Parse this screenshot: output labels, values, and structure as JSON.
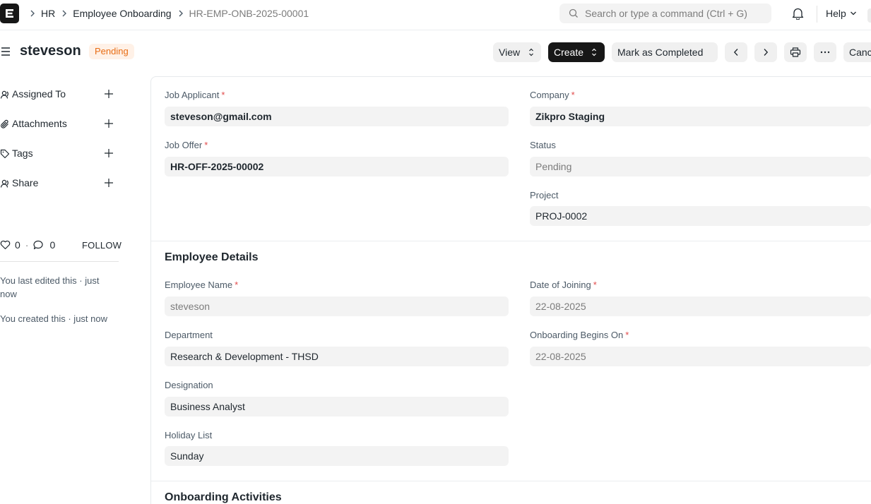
{
  "navbar": {
    "breadcrumbs": [
      "HR",
      "Employee Onboarding",
      "HR-EMP-ONB-2025-00001"
    ],
    "search_placeholder": "Search or type a command (Ctrl + G)",
    "help_label": "Help"
  },
  "page": {
    "title": "steveson",
    "status_badge": "Pending",
    "buttons": {
      "view": "View",
      "create": "Create",
      "mark_completed": "Mark as Completed",
      "cancel": "Cancel"
    }
  },
  "sidebar": {
    "items": [
      {
        "label": "Assigned To",
        "icon": "assign-icon"
      },
      {
        "label": "Attachments",
        "icon": "paperclip-icon"
      },
      {
        "label": "Tags",
        "icon": "tag-icon"
      },
      {
        "label": "Share",
        "icon": "share-icon"
      }
    ],
    "likes": "0",
    "comments": "0",
    "follow_label": "FOLLOW",
    "timeline": [
      "You last edited this · just now",
      "You created this · just now"
    ]
  },
  "form": {
    "job_applicant": {
      "label": "Job Applicant",
      "value": "steveson@gmail.com"
    },
    "company": {
      "label": "Company",
      "value": "Zikpro Staging"
    },
    "job_offer": {
      "label": "Job Offer",
      "value": "HR-OFF-2025-00002"
    },
    "status": {
      "label": "Status",
      "value": "Pending"
    },
    "project": {
      "label": "Project",
      "value": "PROJ-0002"
    },
    "employee_details_title": "Employee Details",
    "employee_name": {
      "label": "Employee Name",
      "value": "steveson"
    },
    "date_of_joining": {
      "label": "Date of Joining",
      "value": "22-08-2025"
    },
    "department": {
      "label": "Department",
      "value": "Research & Development - THSD"
    },
    "onboarding_begins_on": {
      "label": "Onboarding Begins On",
      "value": "22-08-2025"
    },
    "designation": {
      "label": "Designation",
      "value": "Business Analyst"
    },
    "holiday_list": {
      "label": "Holiday List",
      "value": "Sunday"
    },
    "onboarding_activities_title": "Onboarding Activities"
  },
  "colors": {
    "badge_bg": "#fff1e7",
    "badge_text": "#e86c13",
    "required_star": "#e24c4c",
    "primary_button": "#171717"
  }
}
